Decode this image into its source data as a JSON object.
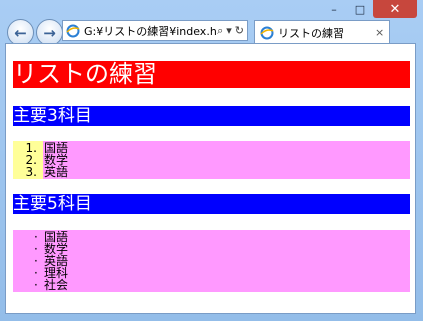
{
  "browser": {
    "address_url": "G:¥リストの練習¥index.htm",
    "tab_title": "リストの練習",
    "tab_close": "×",
    "caption": {
      "minimize": "–",
      "maximize": "□",
      "close": "✕"
    },
    "tools": {
      "search": "⌕",
      "dropdown": "▾",
      "refresh": "↻"
    }
  },
  "page": {
    "heading": "リストの練習",
    "section1": {
      "heading": "主要3科目",
      "items": [
        {
          "marker": "1.",
          "text": "国語"
        },
        {
          "marker": "2.",
          "text": "数学"
        },
        {
          "marker": "3.",
          "text": "英語"
        }
      ]
    },
    "section2": {
      "heading": "主要5科目",
      "items": [
        {
          "marker": "·",
          "text": "国語"
        },
        {
          "marker": "·",
          "text": "数学"
        },
        {
          "marker": "·",
          "text": "英語"
        },
        {
          "marker": "·",
          "text": "理科"
        },
        {
          "marker": "·",
          "text": "社会"
        }
      ]
    }
  },
  "colors": {
    "h1_bg": "#ff0000",
    "h2_bg": "#0000ff",
    "list_bg": "#ff99ff",
    "ol_marker_bg": "#ffff99"
  }
}
